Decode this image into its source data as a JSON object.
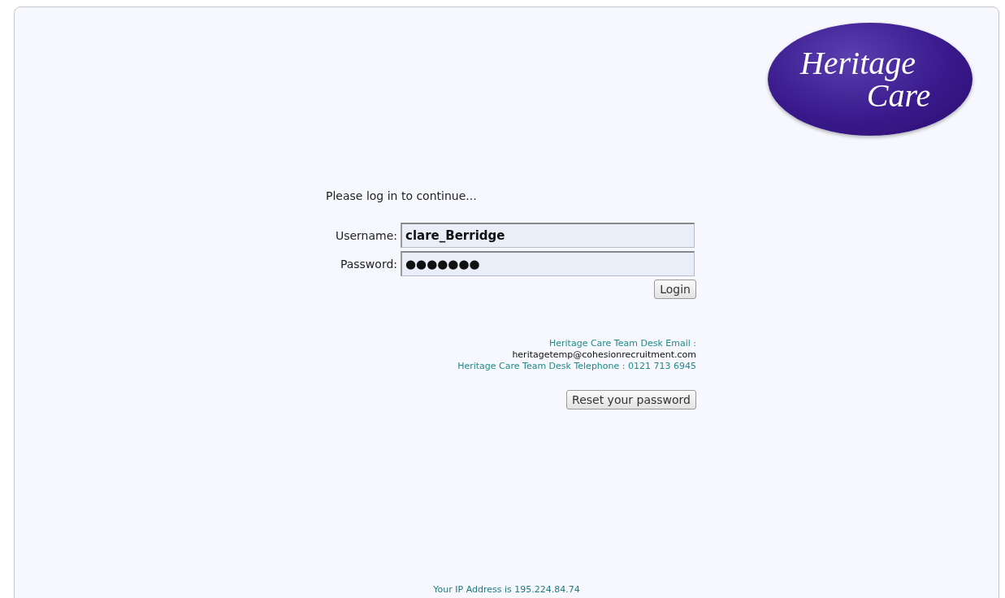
{
  "logo": {
    "line_1": "Heritage",
    "line_2": "Care"
  },
  "prompt": "Please log in to continue...",
  "fields": [
    {
      "label": "Username:",
      "value": "clare_Berridge"
    },
    {
      "label": "Password:",
      "value": "●●●●●●●"
    }
  ],
  "login_button": "Login",
  "contact": {
    "email_label": "Heritage Care Team Desk Email :",
    "email": "heritagetemp@cohesionrecruitment.com",
    "phone": "Heritage Care Team Desk Telephone : 0121 713 6945"
  },
  "reset_button": "Reset your password",
  "ip_text": "Your IP Address is 195.224.84.74"
}
